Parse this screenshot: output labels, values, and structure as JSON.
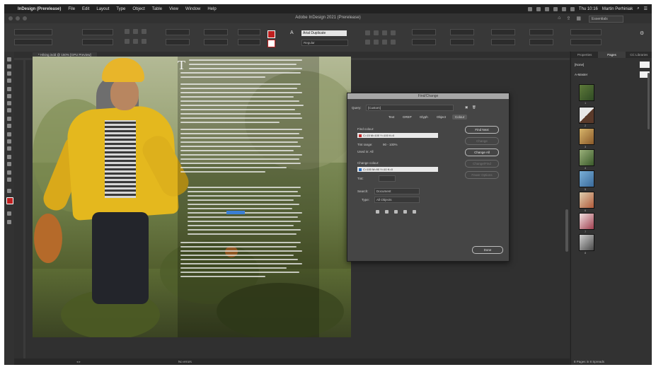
{
  "menubar": {
    "app": "InDesign (Prerelease)",
    "items": [
      "File",
      "Edit",
      "Layout",
      "Type",
      "Object",
      "Table",
      "View",
      "Window",
      "Help"
    ],
    "clock": "Thu 10:16",
    "user": "Martin Perhiniak"
  },
  "window": {
    "title": "Adobe InDesign 2021 (Prerelease)",
    "workspace": "Essentials"
  },
  "controlbar": {
    "font_name": "Arial Duplicate",
    "font_style": "Regular"
  },
  "document_tab": {
    "label": "* Hiking.indd @ 150% [GPU Preview]"
  },
  "find_change": {
    "title": "Find/Change",
    "query_label": "Query:",
    "query_value": "[Custom]",
    "tabs": [
      "Text",
      "GREP",
      "Glyph",
      "Object",
      "Colour"
    ],
    "active_tab": "Colour",
    "find_colour_label": "Find colour:",
    "find_colour_value": "C=15 M=100 Y=100 K=0",
    "tint_range_label": "Tint range:",
    "tint_range_value": "90 - 100%",
    "used_in_label": "Used in: All",
    "change_colour_label": "Change colour:",
    "change_colour_value": "C=100 M=90 Y=10 K=0",
    "tint_label": "Tint:",
    "search_label": "Search:",
    "search_value": "Document",
    "type_label": "Type:",
    "type_value": "All Objects",
    "buttons": {
      "find_next": "Find Next",
      "change": "Change",
      "change_all": "Change All",
      "change_find": "Change/Find",
      "fewer_options": "Fewer Options",
      "done": "Done"
    }
  },
  "pages_panel": {
    "tabs": [
      "Properties",
      "Pages",
      "CC Libraries"
    ],
    "active_tab": "Pages",
    "none_label": "[None]",
    "master_label": "A-Master",
    "page_numbers": [
      "1",
      "2",
      "3",
      "4",
      "5",
      "6",
      "7",
      "8"
    ],
    "status": "8 Pages in 8 Spreads"
  },
  "statusbar": {
    "status": "No errors"
  },
  "colors": {
    "find_swatch": "#c52a2a",
    "change_swatch": "#2a6fc5",
    "accent_yellow": "#e4b81e"
  }
}
